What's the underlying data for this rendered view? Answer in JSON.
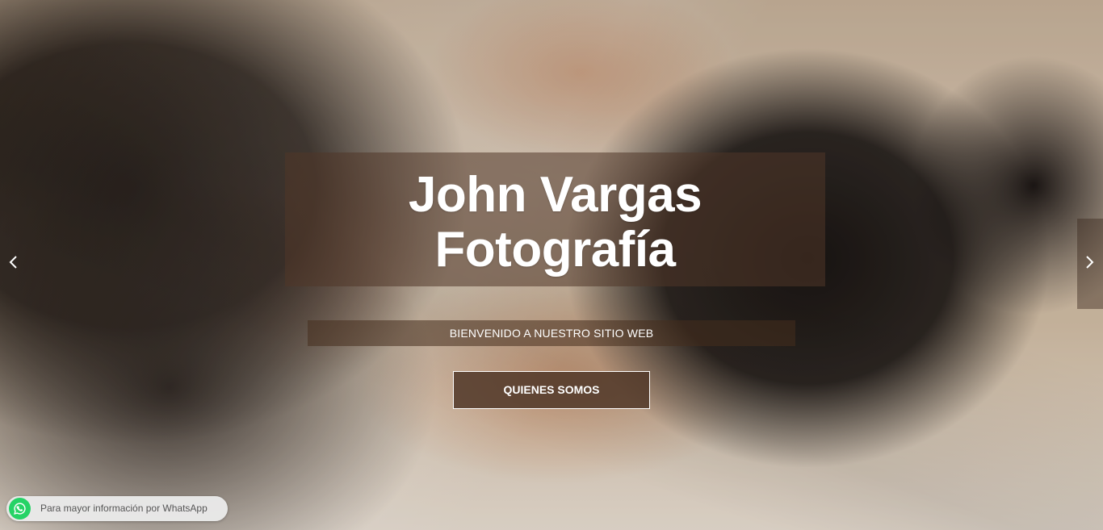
{
  "hero": {
    "title_line1": "John Vargas",
    "title_line2": "Fotografía",
    "subtitle": "BIENVENIDO A NUESTRO SITIO WEB",
    "cta_label": "QUIENES SOMOS"
  },
  "carousel": {
    "prev_icon": "chevron-left-icon",
    "next_icon": "chevron-right-icon"
  },
  "whatsapp": {
    "icon": "whatsapp-icon",
    "label": "Para mayor información por WhatsApp",
    "color": "#25d366"
  },
  "colors": {
    "overlay": "#50372a",
    "text": "#ffffff"
  }
}
